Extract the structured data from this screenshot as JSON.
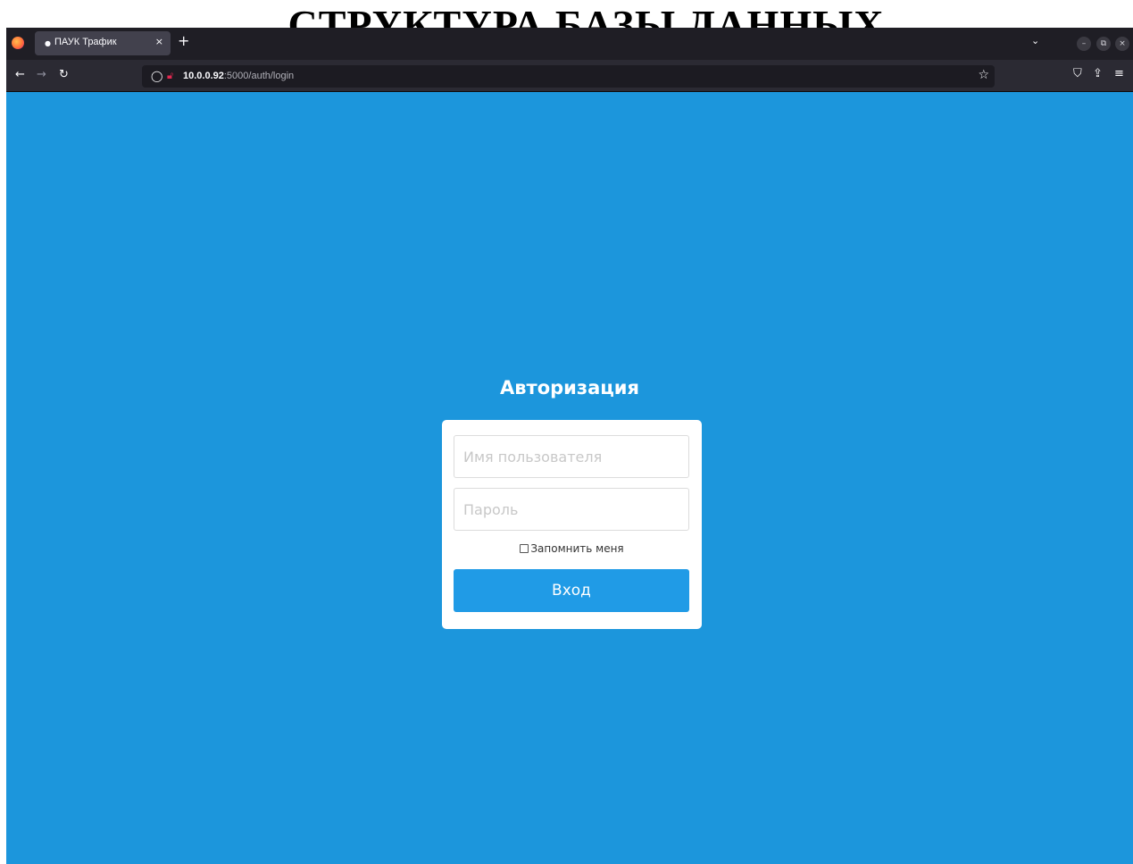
{
  "document": {
    "heading": "СТРУКТУРА БАЗЫ ДАННЫХ"
  },
  "browser": {
    "tab": {
      "title": "ПАУК Трафик",
      "close": "×"
    },
    "new_tab": "+",
    "url": {
      "host": "10.0.0.92",
      "rest": ":5000/auth/login"
    }
  },
  "login": {
    "title": "Авторизация",
    "username_placeholder": "Имя пользователя",
    "password_placeholder": "Пароль",
    "remember_label": "Запомнить меня",
    "submit_label": "Вход"
  },
  "colors": {
    "background": "#1c96dc",
    "button": "#209be6",
    "card": "#ffffff"
  }
}
